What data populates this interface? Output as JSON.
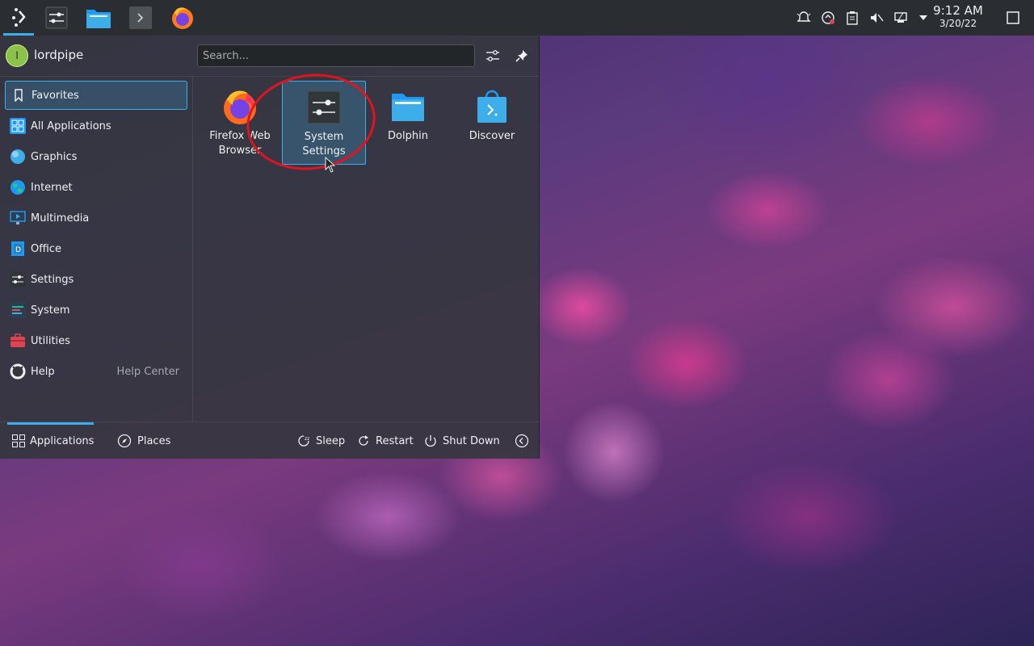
{
  "panel": {
    "clock": {
      "time": "9:12 AM",
      "date": "3/20/22"
    }
  },
  "menu": {
    "user": {
      "initial": "l",
      "name": "lordpipe"
    },
    "search": {
      "placeholder": "Search..."
    },
    "categories": [
      {
        "label": "Favorites",
        "icon": "bookmark-icon",
        "selected": true
      },
      {
        "label": "All Applications",
        "icon": "grid-icon"
      },
      {
        "label": "Graphics",
        "icon": "graphics-icon"
      },
      {
        "label": "Internet",
        "icon": "globe-icon"
      },
      {
        "label": "Multimedia",
        "icon": "monitor-icon"
      },
      {
        "label": "Office",
        "icon": "office-icon"
      },
      {
        "label": "Settings",
        "icon": "settings-icon"
      },
      {
        "label": "System",
        "icon": "system-icon"
      },
      {
        "label": "Utilities",
        "icon": "toolbox-icon"
      },
      {
        "label": "Help",
        "icon": "lifebuoy-icon",
        "sublabel": "Help Center"
      }
    ],
    "favorites": [
      {
        "label": "Firefox Web Browser",
        "icon": "firefox-icon"
      },
      {
        "label": "System Settings",
        "icon": "system-settings-icon",
        "highlighted": true
      },
      {
        "label": "Dolphin",
        "icon": "folder-icon"
      },
      {
        "label": "Discover",
        "icon": "discover-icon"
      }
    ],
    "footer": {
      "tabs": [
        {
          "label": "Applications",
          "active": true
        },
        {
          "label": "Places"
        }
      ],
      "power": [
        {
          "label": "Sleep"
        },
        {
          "label": "Restart"
        },
        {
          "label": "Shut Down"
        }
      ]
    }
  },
  "colors": {
    "accent": "#3daee9",
    "annotation": "#e0141e",
    "panel": "#2a2e32"
  }
}
